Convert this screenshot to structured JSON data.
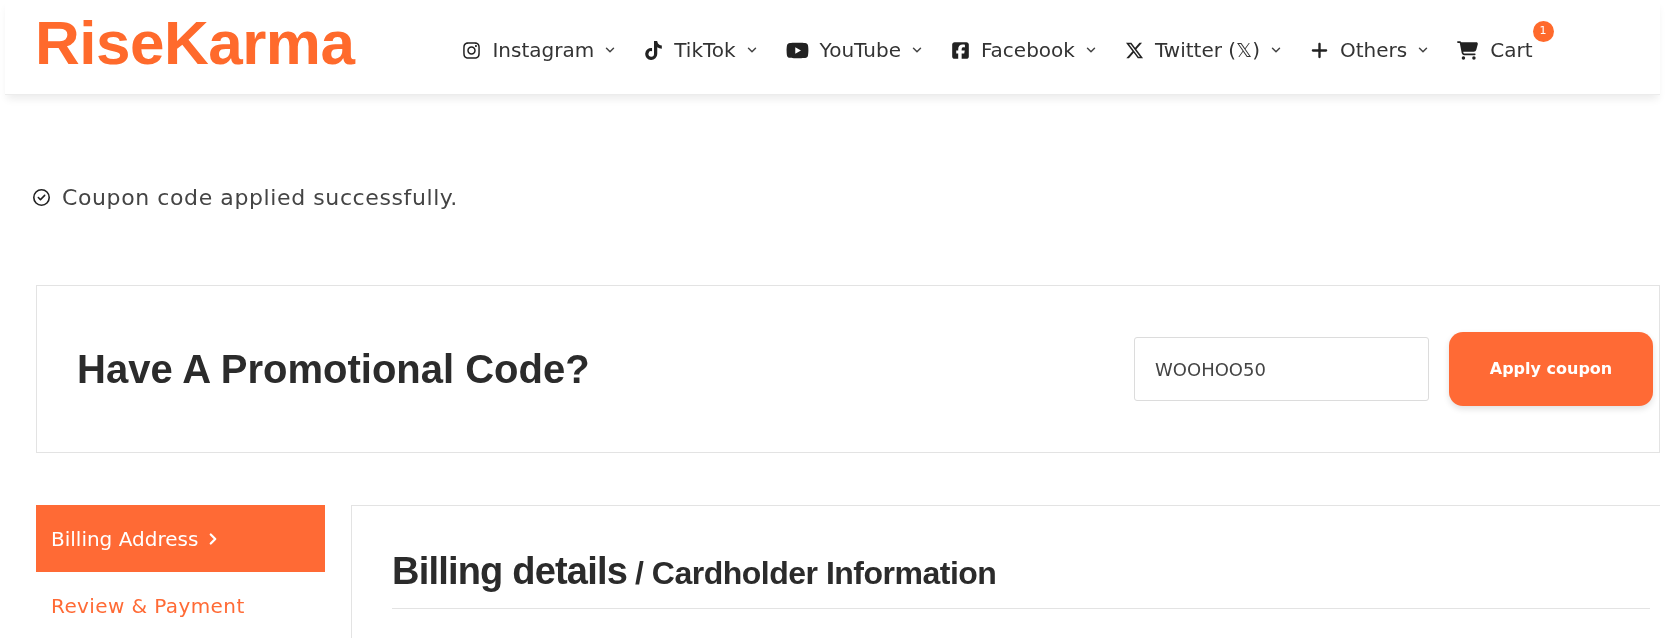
{
  "header": {
    "logo": "RiseKarma",
    "nav": [
      {
        "kind": "instagram",
        "label": "Instagram"
      },
      {
        "kind": "tiktok",
        "label": "TikTok"
      },
      {
        "kind": "youtube",
        "label": "YouTube"
      },
      {
        "kind": "facebook",
        "label": "Facebook"
      },
      {
        "kind": "x",
        "label": "Twitter (𝕏)"
      },
      {
        "kind": "plus",
        "label": "Others"
      }
    ],
    "cart": {
      "label": "Cart",
      "badge": "1"
    }
  },
  "notice": {
    "text": "Coupon code applied successfully."
  },
  "promo": {
    "heading": "Have A Promotional Code?",
    "field": {
      "value": "WOOHOO50"
    },
    "button": "Apply coupon"
  },
  "steps": [
    {
      "label": "Billing Address",
      "selected": true
    },
    {
      "label": "Review & Payment",
      "selected": false
    }
  ],
  "billing": {
    "title": "Billing details",
    "subtitle": "/ Cardholder Information"
  }
}
